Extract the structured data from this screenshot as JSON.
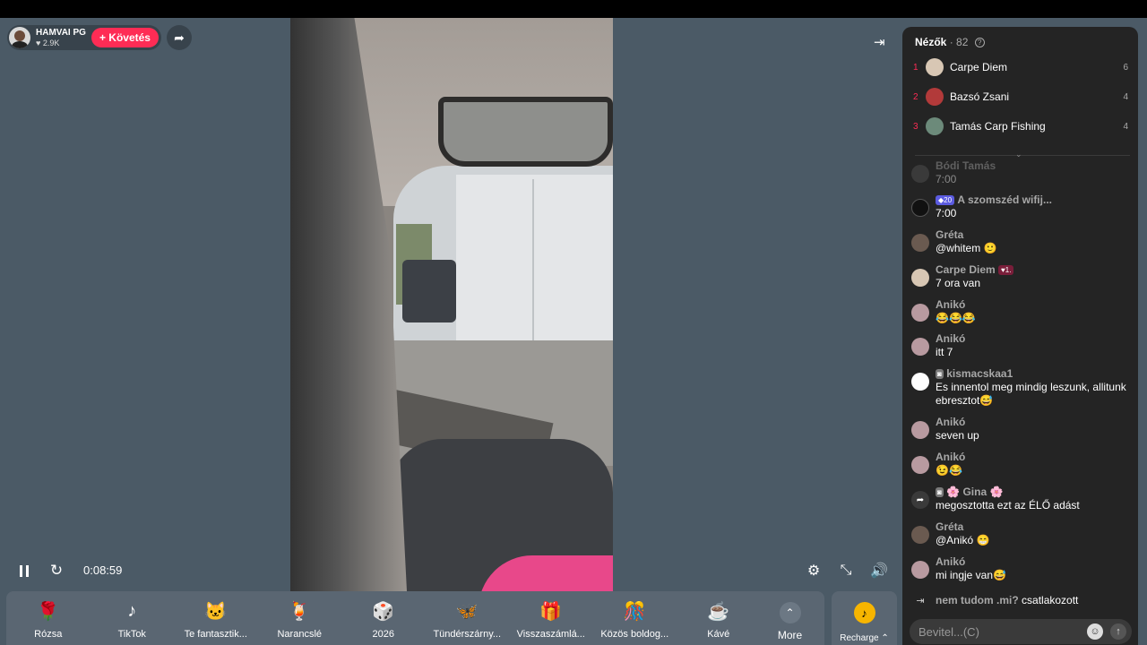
{
  "host": {
    "name": "HAMVAI PG",
    "likes": "2.9K",
    "follow_label": "+ Követés"
  },
  "player": {
    "time": "0:08:59"
  },
  "gifts": [
    {
      "name": "Rózsa",
      "icon": "rose-icon",
      "glyph": "🌹"
    },
    {
      "name": "TikTok",
      "icon": "tiktok-icon",
      "glyph": "♪"
    },
    {
      "name": "Te fantasztik...",
      "icon": "cat-icon",
      "glyph": "🐱"
    },
    {
      "name": "Narancslé",
      "icon": "orange-juice-icon",
      "glyph": "🍹"
    },
    {
      "name": "2026",
      "icon": "2026-icon",
      "glyph": "🎲"
    },
    {
      "name": "Tündérszárny...",
      "icon": "fairy-wings-icon",
      "glyph": "🦋"
    },
    {
      "name": "Visszaszámlá...",
      "icon": "countdown-icon",
      "glyph": "🎁"
    },
    {
      "name": "Közös boldog...",
      "icon": "celebration-icon",
      "glyph": "🎊"
    },
    {
      "name": "Kávé",
      "icon": "coffee-icon",
      "glyph": "☕"
    }
  ],
  "more_label": "More",
  "recharge_label": "Recharge ⌃",
  "viewers": {
    "title": "Nézők",
    "count": "82",
    "list": [
      {
        "rank": "1",
        "name": "Carpe Diem",
        "score": "6",
        "avatar_color": "#d8c7b4"
      },
      {
        "rank": "2",
        "name": "Bazsó Zsani",
        "score": "4",
        "avatar_color": "#b23a3a"
      },
      {
        "rank": "3",
        "name": "Tamás Carp Fishing",
        "score": "4",
        "avatar_color": "#6c8a7a"
      }
    ]
  },
  "chat": {
    "messages": [
      {
        "user": "Bódi Tamás",
        "text": "7:00",
        "avatar_color": "#555"
      },
      {
        "user": "A szomszéd wifij...",
        "text": "7:00",
        "badge_lvl": "20",
        "avatar_color": "#111"
      },
      {
        "user": "Gréta",
        "text": "@whitem 🙂",
        "avatar_color": "#6a5a50"
      },
      {
        "user": "Carpe Diem",
        "text": "7 ora van",
        "badge_fan": "1.",
        "avatar_color": "#d8c7b4"
      },
      {
        "user": "Anikó",
        "text": "😂😂😂",
        "avatar_color": "#b89aa0"
      },
      {
        "user": "Anikó",
        "text": "itt 7",
        "avatar_color": "#b89aa0"
      },
      {
        "user": "kismacskaa1",
        "text": "Es innentol meg mindig leszunk, allitunk ebresztot😅",
        "avatar_color": "#ffffff"
      },
      {
        "user": "Anikó",
        "text": "seven up",
        "avatar_color": "#b89aa0"
      },
      {
        "user": "Anikó",
        "text": "😉😂",
        "avatar_color": "#b89aa0"
      },
      {
        "user": "🌸 Gina 🌸",
        "text": "megosztotta ezt az ÉLŐ adást"
      },
      {
        "user": "Gréta",
        "text": "@Anikó 😁",
        "avatar_color": "#6a5a50"
      },
      {
        "user": "Anikó",
        "text": "mi ingje van😅",
        "avatar_color": "#b89aa0"
      }
    ],
    "join": {
      "user": "nem tudom .mi?",
      "text": "csatlakozott"
    },
    "input_placeholder": "Bevitel...(C)"
  }
}
